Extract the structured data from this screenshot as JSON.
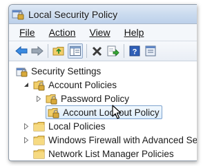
{
  "window": {
    "title": "Local Security Policy",
    "title_icon": "security-policy-icon"
  },
  "menu": [
    {
      "label": "File"
    },
    {
      "label": "Action"
    },
    {
      "label": "View"
    },
    {
      "label": "Help"
    }
  ],
  "toolbar": {
    "buttons": [
      "back-arrow-icon",
      "forward-arrow-icon",
      "up-folder-icon",
      "show-hide-tree-icon",
      "delete-icon",
      "export-list-icon",
      "help-icon",
      "properties-icon"
    ]
  },
  "tree": {
    "root": {
      "label": "Security Settings",
      "icon": "security-settings-icon"
    },
    "account_policies": {
      "label": "Account Policies",
      "expanded": true
    },
    "password_policy": {
      "label": "Password Policy",
      "expanded": false
    },
    "account_lockout_policy": {
      "label": "Account Lockout Policy",
      "selected": true
    },
    "local_policies": {
      "label": "Local Policies",
      "expanded": false
    },
    "windows_firewall": {
      "label": "Windows Firewall with Advanced Secu",
      "expanded": false
    },
    "network_list": {
      "label": "Network List Manager Policies"
    }
  },
  "colors": {
    "folder": "#f2cf6a",
    "folder_dark": "#c9a23a",
    "lock": "#d8a93a",
    "selection_border": "#7da2ce",
    "arrow_blue": "#2f7fd8"
  }
}
